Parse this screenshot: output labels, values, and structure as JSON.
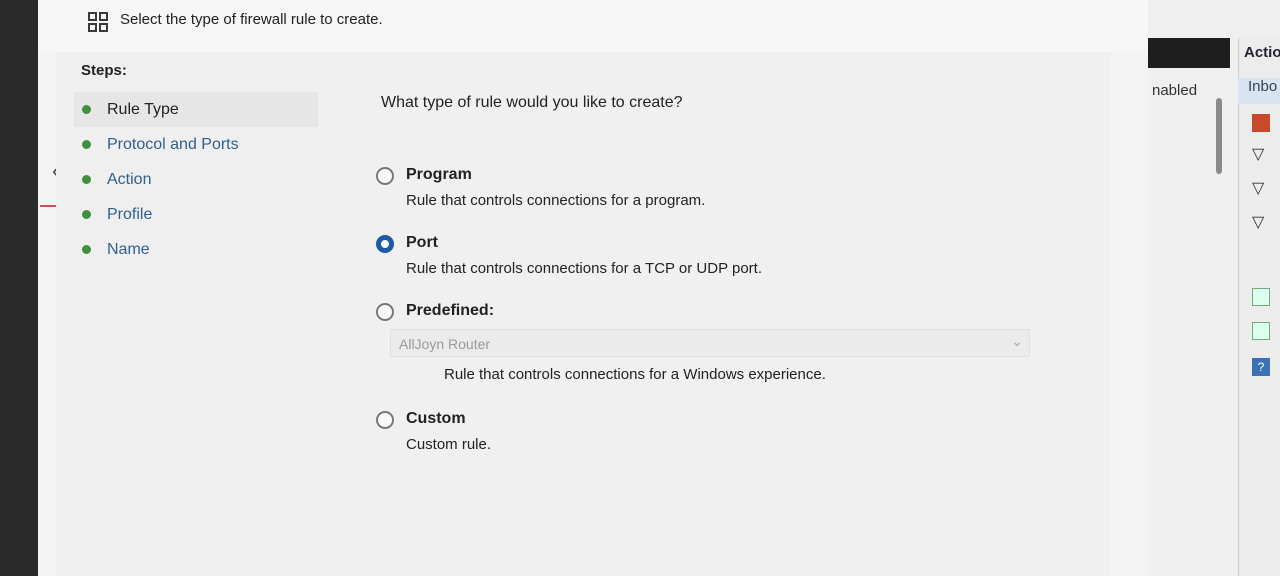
{
  "dialog": {
    "header_text": "Select the type of firewall rule to create."
  },
  "steps": {
    "title": "Steps:",
    "items": [
      {
        "label": "Rule Type",
        "active": true
      },
      {
        "label": "Protocol and Ports",
        "active": false
      },
      {
        "label": "Action",
        "active": false
      },
      {
        "label": "Profile",
        "active": false
      },
      {
        "label": "Name",
        "active": false
      }
    ]
  },
  "content": {
    "question": "What type of rule would you like to create?",
    "options": {
      "program": {
        "title": "Program",
        "description": "Rule that controls connections for a program.",
        "checked": false
      },
      "port": {
        "title": "Port",
        "description": "Rule that controls connections for a TCP or UDP port.",
        "checked": true
      },
      "predefined": {
        "title": "Predefined:",
        "description": "Rule that controls connections for a Windows experience.",
        "checked": false
      },
      "custom": {
        "title": "Custom",
        "description": "Custom rule.",
        "checked": false
      }
    },
    "predefined_dropdown": {
      "value": "AllJoyn Router"
    }
  },
  "background_window": {
    "column_text": "nabled",
    "actions_header": "Actio",
    "actions_sub": "Inbo"
  },
  "colors": {
    "accent": "#1a5aa6",
    "step_link": "#2f5f91",
    "step_bullet": "#3e8f3e"
  }
}
